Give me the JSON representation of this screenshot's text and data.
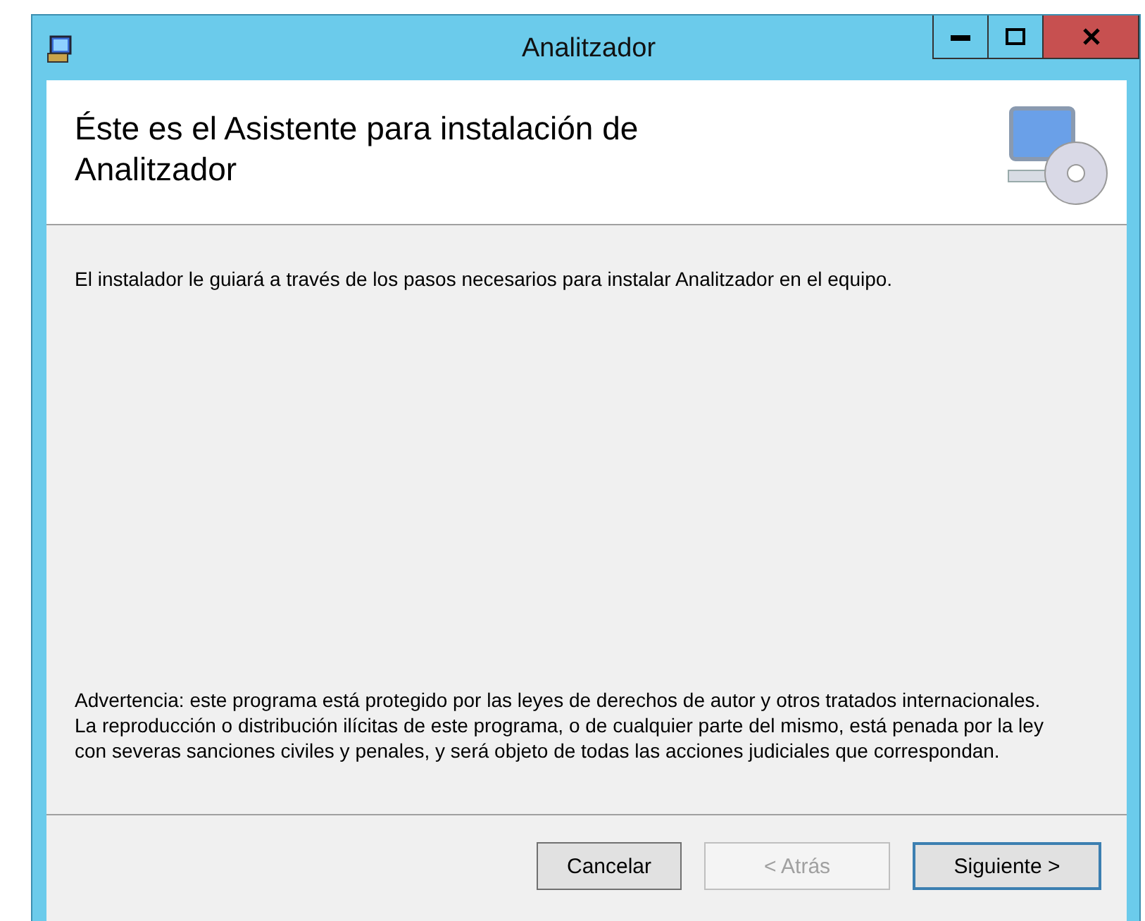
{
  "window": {
    "title": "Analitzador"
  },
  "header": {
    "title": "Éste es el Asistente para instalación de Analitzador"
  },
  "intro": "El instalador le guiará a través de los pasos necesarios para instalar Analitzador en el equipo.",
  "warning": "Advertencia: este programa está protegido por las leyes de derechos de autor y otros tratados internacionales. La reproducción o distribución ilícitas de este programa, o de cualquier parte del mismo, está penada por la ley con severas sanciones civiles y penales, y será objeto de todas las acciones judiciales que correspondan.",
  "buttons": [
    {
      "label": "Cancelar",
      "disabled": false,
      "default": false
    },
    {
      "label": "< Atrás",
      "disabled": true,
      "default": false
    },
    {
      "label": "Siguiente >",
      "disabled": false,
      "default": true
    }
  ]
}
